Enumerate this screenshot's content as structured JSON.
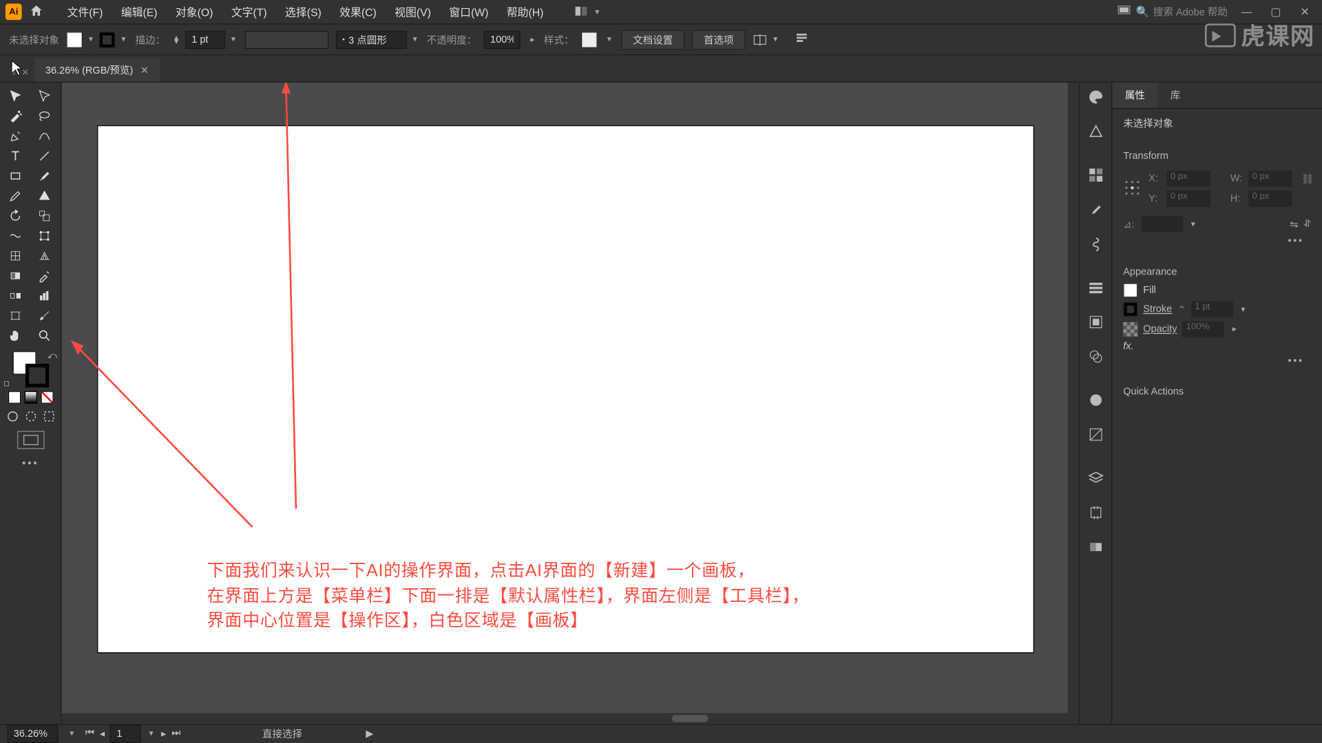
{
  "menu": {
    "items": [
      "文件(F)",
      "编辑(E)",
      "对象(O)",
      "文字(T)",
      "选择(S)",
      "效果(C)",
      "视图(V)",
      "窗口(W)",
      "帮助(H)"
    ],
    "search_placeholder": "搜索 Adobe 帮助"
  },
  "controlbar": {
    "selection": "未选择对象",
    "stroke_label": "描边：",
    "stroke_weight": "1 pt",
    "brush_label": "3 点圆形",
    "opacity_label": "不透明度：",
    "opacity_value": "100%",
    "style_label": "样式：",
    "docsetup": "文档设置",
    "prefs": "首选项"
  },
  "doc": {
    "tab": "36.26% (RGB/预览)"
  },
  "tools": {
    "names": [
      "selection",
      "direct-selection",
      "magic-wand",
      "lasso",
      "pen",
      "curvature",
      "type",
      "line-segment",
      "rectangle",
      "paintbrush",
      "pencil",
      "shaper",
      "rotate",
      "scale",
      "width",
      "free-transform",
      "mesh",
      "perspective-grid",
      "gradient",
      "eyedropper",
      "blend",
      "column-graph",
      "artboard",
      "slice",
      "hand",
      "zoom"
    ]
  },
  "panelstrip": [
    "color",
    "color-guide",
    "swatches",
    "brushes",
    "symbols",
    "stroke-panel",
    "align",
    "pathfinder",
    "transparency",
    "appearance",
    "graphic-styles",
    "layers",
    "artboards",
    "links"
  ],
  "properties": {
    "tabs": [
      "属性",
      "库"
    ],
    "subtitle": "未选择对象",
    "transform_hd": "Transform",
    "x_lbl": "X:",
    "y_lbl": "Y:",
    "w_lbl": "W:",
    "h_lbl": "H:",
    "angle_lbl": "⊿:",
    "x_val": "0 px",
    "y_val": "0 px",
    "w_val": "0 px",
    "h_val": "0 px",
    "appearance_hd": "Appearance",
    "fill_lbl": "Fill",
    "stroke_lbl": "Stroke",
    "stroke_val": "1 pt",
    "opacity_lbl": "Opacity",
    "opacity_val": "100%",
    "fx_lbl": "fx.",
    "quick_hd": "Quick Actions"
  },
  "status": {
    "zoom": "36.26%",
    "page": "1",
    "tool": "直接选择"
  },
  "annotation": {
    "line1": "下面我们来认识一下AI的操作界面，点击AI界面的【新建】一个画板，",
    "line2": "在界面上方是【菜单栏】下面一排是【默认属性栏】，界面左侧是【工具栏】，",
    "line3": "界面中心位置是【操作区】，白色区域是【画板】"
  },
  "watermark": "虎课网"
}
